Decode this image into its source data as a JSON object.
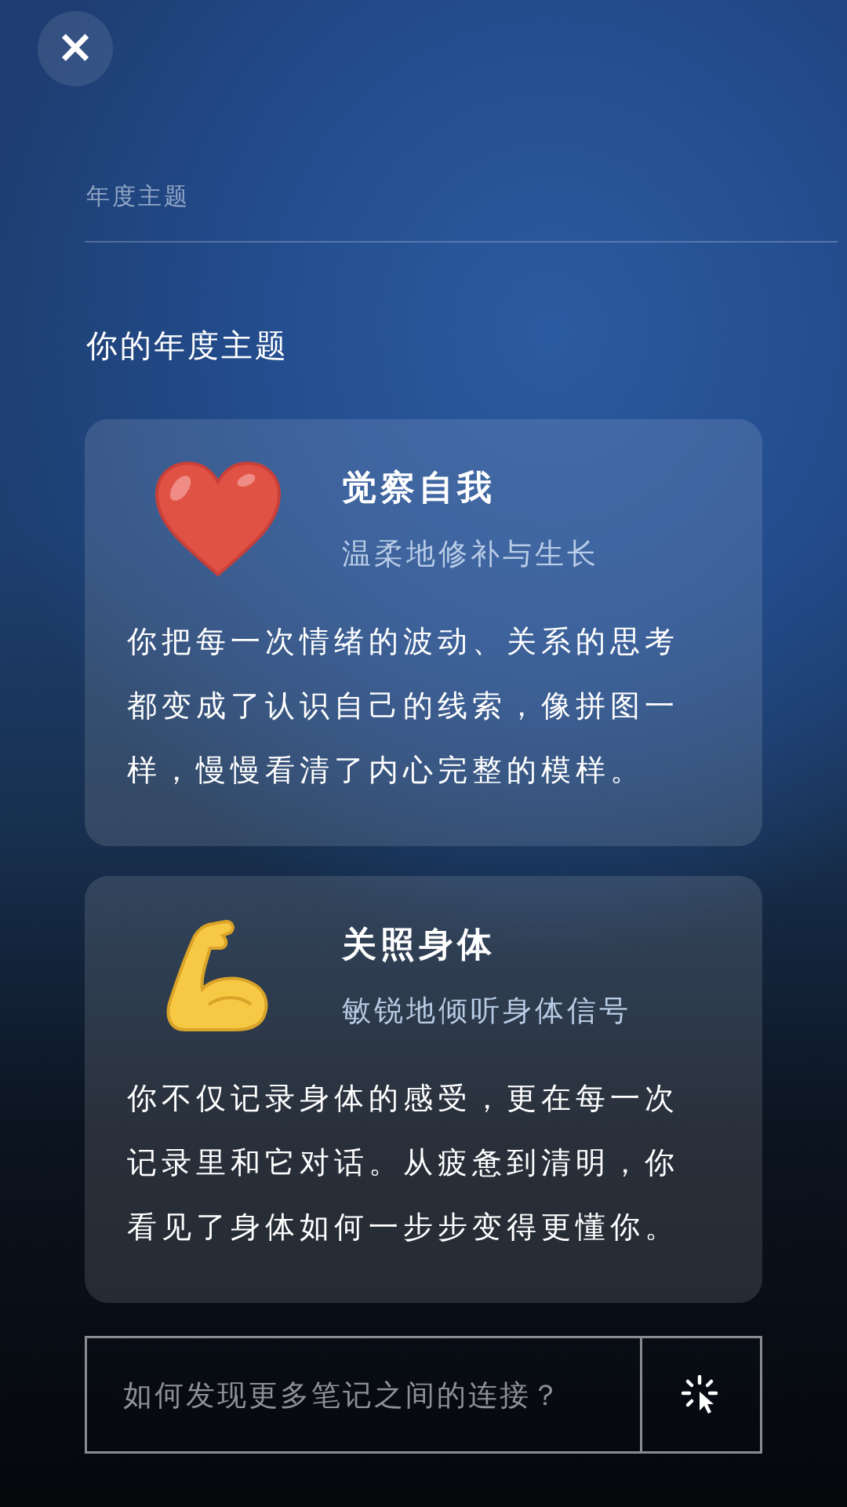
{
  "close_button": {
    "label": "×"
  },
  "section_label": "年度主题",
  "heading": "你的年度主题",
  "themes": [
    {
      "kind": "heart",
      "title": "觉察自我",
      "subtitle": "温柔地修补与生长",
      "body": "你把每一次情绪的波动、关系的思考都变成了认识自己的线索，像拼图一样，慢慢看清了内心完整的模样。"
    },
    {
      "kind": "arm",
      "title": "关照身体",
      "subtitle": "敏锐地倾听身体信号",
      "body": "你不仅记录身体的感受，更在每一次记录里和它对话。从疲惫到清明，你看见了身体如何一步步变得更懂你。"
    }
  ],
  "question_field": {
    "placeholder": "如何发现更多笔记之间的连接？"
  }
}
